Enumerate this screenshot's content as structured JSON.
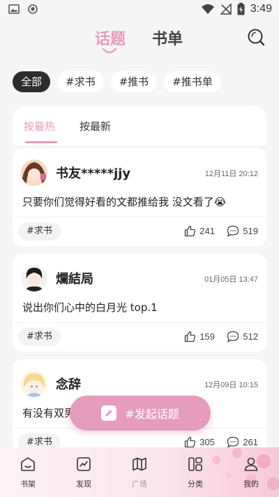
{
  "status_bar": {
    "time": "3:49"
  },
  "header": {
    "tabs": [
      "话题",
      "书单"
    ]
  },
  "filters": [
    "全部",
    "#求书",
    "#推书",
    "#推书单"
  ],
  "sort_tabs": [
    "按最热",
    "按最新"
  ],
  "posts": [
    {
      "author": "书友*****jjy",
      "date": "12月11日 20:12",
      "content": "只要你们觉得好看的文都推给我 没文看了😭",
      "tag": "#求书",
      "likes": "241",
      "comments": "519"
    },
    {
      "author": "爛結局",
      "date": "01月05日 13:47",
      "content": "说出你们心中的白月光 top.1",
      "tag": "#求书",
      "likes": "159",
      "comments": "512"
    },
    {
      "author": "念辞",
      "date": "12月09日 10:15",
      "content": "有没有双男",
      "tag": "#求书",
      "likes": "305",
      "comments": "261"
    }
  ],
  "fab": {
    "label": "#发起话题"
  },
  "nav": [
    {
      "label": "书架",
      "icon": "bookshelf-icon"
    },
    {
      "label": "发现",
      "icon": "discover-icon"
    },
    {
      "label": "广场",
      "icon": "square-map-icon"
    },
    {
      "label": "分类",
      "icon": "category-icon"
    },
    {
      "label": "我的",
      "icon": "profile-icon"
    }
  ],
  "colors": {
    "accent": "#e79bbd",
    "chip_active": "#2d2d2d",
    "background": "#f5f5f6"
  }
}
